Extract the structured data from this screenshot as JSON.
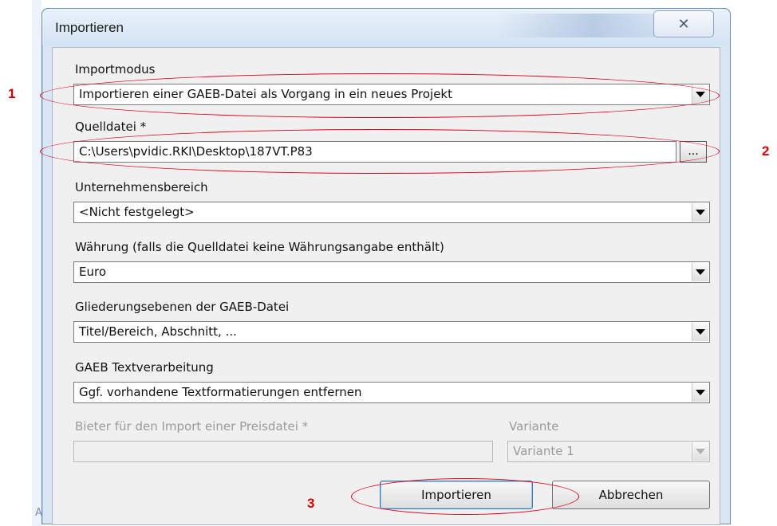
{
  "dialog": {
    "title": "Importieren",
    "close_glyph": "✕"
  },
  "form": {
    "import_mode": {
      "label": "Importmodus",
      "value": "Importieren einer GAEB-Datei als Vorgang in ein neues Projekt"
    },
    "source_file": {
      "label": "Quelldatei *",
      "value": "C:\\Users\\pvidic.RKI\\Desktop\\187VT.P83",
      "browse_label": "..."
    },
    "business_area": {
      "label": "Unternehmensbereich",
      "value": "<Nicht festgelegt>"
    },
    "currency": {
      "label": "Währung (falls die Quelldatei keine Währungsangabe enthält)",
      "value": "Euro"
    },
    "structure_levels": {
      "label": "Gliederungsebenen der GAEB-Datei",
      "value": "Titel/Bereich, Abschnitt, ..."
    },
    "text_processing": {
      "label": "GAEB Textverarbeitung",
      "value": "Ggf. vorhandene Textformatierungen entfernen"
    },
    "bidder": {
      "label": "Bieter für den Import einer Preisdatei *",
      "value": ""
    },
    "variant": {
      "label": "Variante",
      "value": "Variante 1"
    }
  },
  "buttons": {
    "import_label": "Importieren",
    "cancel_label": "Abbrechen"
  },
  "annotations": {
    "marker_1": "1",
    "marker_2": "2",
    "marker_3": "3",
    "color": "#e0001a"
  },
  "background": {
    "left_text": "AE"
  }
}
